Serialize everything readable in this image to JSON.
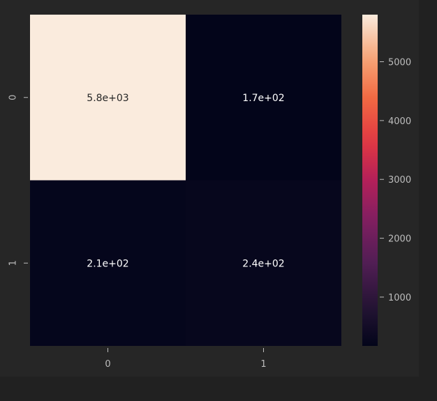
{
  "chart_data": {
    "type": "heatmap",
    "title": "",
    "xlabel": "",
    "ylabel": "",
    "x_tick_labels": [
      "0",
      "1"
    ],
    "y_tick_labels": [
      "0",
      "1"
    ],
    "values": [
      [
        5800,
        170
      ],
      [
        210,
        240
      ]
    ],
    "annotations": [
      [
        "5.8e+03",
        "1.7e+02"
      ],
      [
        "2.1e+02",
        "2.4e+02"
      ]
    ],
    "colorbar": {
      "range": [
        170,
        5800
      ],
      "ticks": [
        1000,
        2000,
        3000,
        4000,
        5000
      ],
      "tick_labels": [
        "1000",
        "2000",
        "3000",
        "4000",
        "5000"
      ],
      "colormap": "rocket"
    },
    "grid": false
  },
  "colors": {
    "figure_background": "#212121",
    "axes_background": "#262626",
    "tick_label_color": "#bdbdbd",
    "annotation_dark_text": "#262626",
    "annotation_light_text": "#ffffff"
  }
}
